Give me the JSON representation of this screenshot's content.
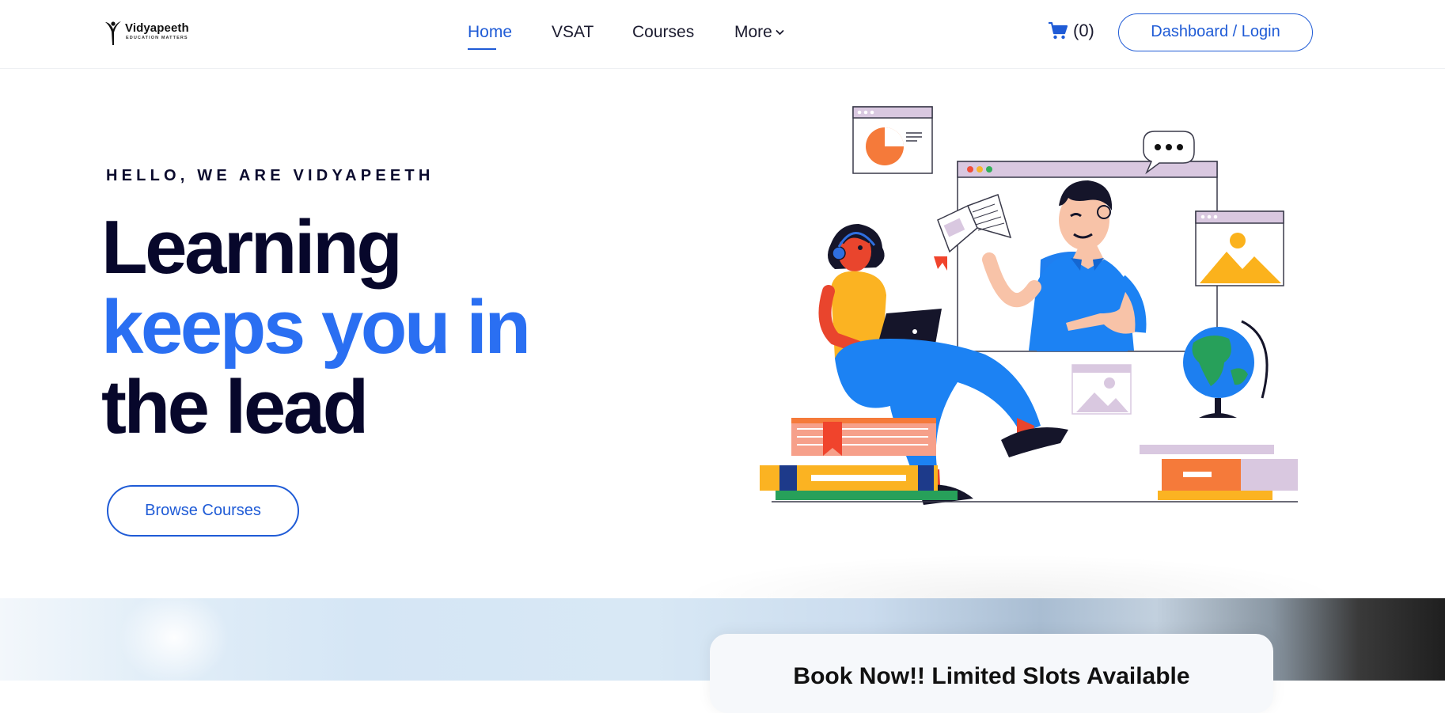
{
  "header": {
    "logo": {
      "name": "Vidyapeeth",
      "tagline": "EDUCATION MATTERS"
    },
    "nav": [
      {
        "label": "Home",
        "active": true
      },
      {
        "label": "VSAT",
        "active": false
      },
      {
        "label": "Courses",
        "active": false
      },
      {
        "label": "More",
        "active": false,
        "has_dropdown": true
      }
    ],
    "cart": {
      "icon": "cart-icon",
      "count_label": "(0)"
    },
    "login_label": "Dashboard / Login"
  },
  "hero": {
    "eyebrow": "HELLO, WE ARE VIDYAPEETH",
    "headline": {
      "line1": "Learning",
      "line2": "keeps you in",
      "line3": "the lead"
    },
    "cta_label": "Browse Courses",
    "illustration": "teacher-and-student-online-learning"
  },
  "booking": {
    "title": "Book Now!! Limited Slots Available"
  },
  "colors": {
    "accent": "#1f5bd6",
    "headline_blue": "#2a6ff2",
    "headline_dark": "#07072b"
  }
}
